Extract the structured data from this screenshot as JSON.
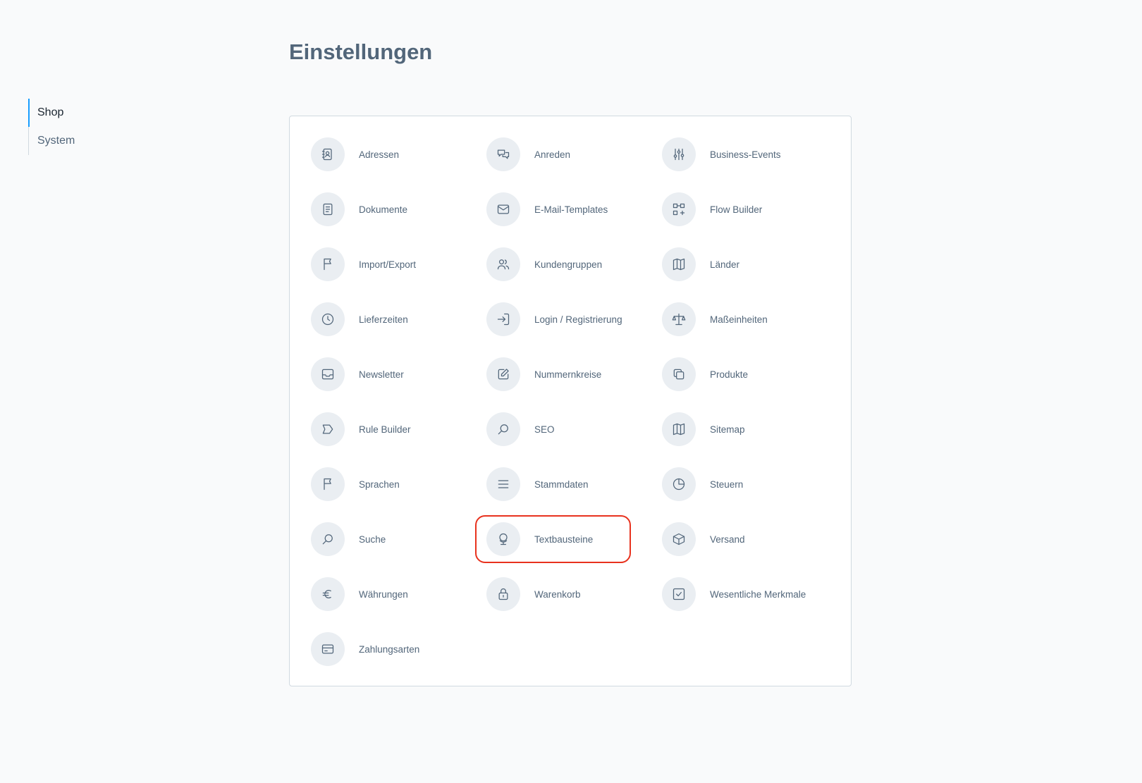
{
  "page": {
    "title": "Einstellungen"
  },
  "sidebar": {
    "items": [
      {
        "label": "Shop",
        "active": true
      },
      {
        "label": "System",
        "active": false
      }
    ]
  },
  "settings": {
    "items": [
      {
        "label": "Adressen",
        "icon": "address-book-icon"
      },
      {
        "label": "Anreden",
        "icon": "chat-bubbles-icon"
      },
      {
        "label": "Business-Events",
        "icon": "sliders-icon"
      },
      {
        "label": "Dokumente",
        "icon": "document-icon"
      },
      {
        "label": "E-Mail-Templates",
        "icon": "envelope-icon"
      },
      {
        "label": "Flow Builder",
        "icon": "flow-icon"
      },
      {
        "label": "Import/Export",
        "icon": "flag-icon"
      },
      {
        "label": "Kundengruppen",
        "icon": "users-icon"
      },
      {
        "label": "Länder",
        "icon": "map-icon"
      },
      {
        "label": "Lieferzeiten",
        "icon": "clock-icon"
      },
      {
        "label": "Login / Registrierung",
        "icon": "sign-in-icon"
      },
      {
        "label": "Maßeinheiten",
        "icon": "scale-icon"
      },
      {
        "label": "Newsletter",
        "icon": "inbox-icon"
      },
      {
        "label": "Nummernkreise",
        "icon": "edit-icon"
      },
      {
        "label": "Produkte",
        "icon": "duplicate-icon"
      },
      {
        "label": "Rule Builder",
        "icon": "tag-icon"
      },
      {
        "label": "SEO",
        "icon": "search-icon"
      },
      {
        "label": "Sitemap",
        "icon": "map-icon"
      },
      {
        "label": "Sprachen",
        "icon": "flag-icon"
      },
      {
        "label": "Stammdaten",
        "icon": "list-icon"
      },
      {
        "label": "Steuern",
        "icon": "pie-chart-icon"
      },
      {
        "label": "Suche",
        "icon": "search-icon"
      },
      {
        "label": "Textbausteine",
        "icon": "globe-icon",
        "highlighted": true
      },
      {
        "label": "Versand",
        "icon": "box-icon"
      },
      {
        "label": "Währungen",
        "icon": "euro-icon"
      },
      {
        "label": "Warenkorb",
        "icon": "lock-icon"
      },
      {
        "label": "Wesentliche Merkmale",
        "icon": "checkbox-icon"
      },
      {
        "label": "Zahlungsarten",
        "icon": "credit-card-icon"
      }
    ]
  },
  "colors": {
    "accent": "#189eff",
    "highlight": "#e8321e",
    "icon_bg": "#eaeef2",
    "text": "#52667a"
  }
}
